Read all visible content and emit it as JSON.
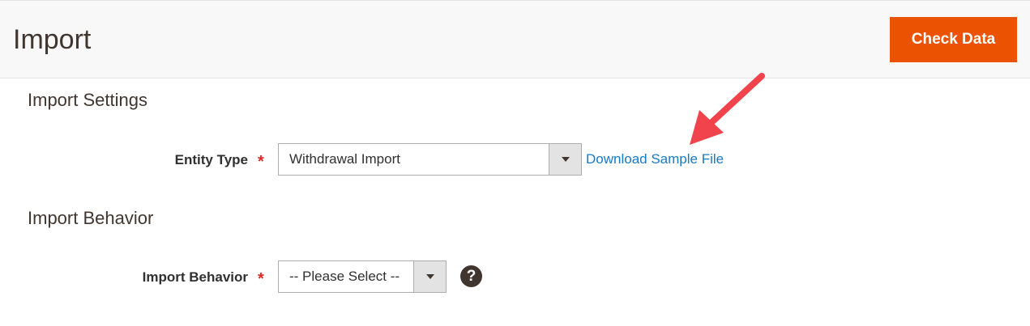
{
  "header": {
    "title": "Import",
    "check_data_label": "Check Data"
  },
  "import_settings": {
    "section_title": "Import Settings",
    "entity_type": {
      "label": "Entity Type",
      "required_mark": "*",
      "selected": "Withdrawal Import"
    },
    "download_link": "Download Sample File"
  },
  "import_behavior": {
    "section_title": "Import Behavior",
    "behavior": {
      "label": "Import Behavior",
      "required_mark": "*",
      "selected": "-- Please Select --"
    },
    "help_glyph": "?"
  },
  "colors": {
    "accent": "#eb5202",
    "link": "#1979c3",
    "required": "#e22626",
    "annotation_arrow": "#f0434b"
  },
  "icons": [
    "chevron-down-icon",
    "question-icon",
    "annotation-arrow-icon"
  ]
}
